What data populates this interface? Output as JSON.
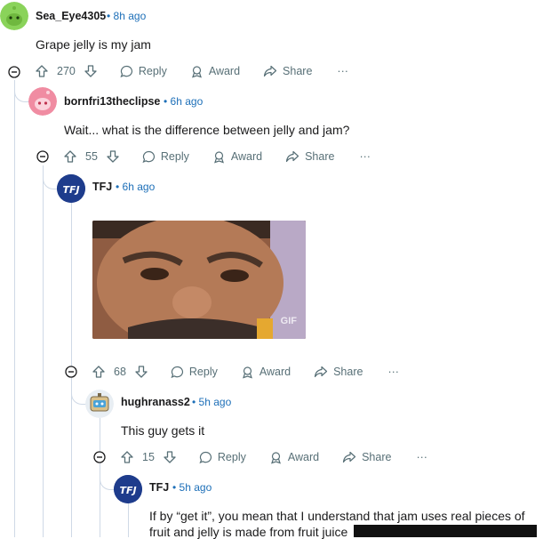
{
  "comments": [
    {
      "author": "Sea_Eye4305",
      "time": "8h ago",
      "text": "Grape jelly is my jam",
      "votes": "270",
      "avatar_color": "#8ad35a"
    },
    {
      "author": "bornfri13theclipse",
      "time": "6h ago",
      "text": "Wait... what is the difference between jelly and jam?",
      "votes": "55",
      "avatar_color": "#f08ca2"
    },
    {
      "author": "TFJ",
      "time": "6h ago",
      "text": "",
      "votes": "68",
      "avatar_color": "#1e3c8c",
      "avatar_text": "TFJ",
      "gif_label": "GIF"
    },
    {
      "author": "hughranass2",
      "time": "5h ago",
      "text": "This guy gets it",
      "votes": "15",
      "avatar_color": "#d9c08a"
    },
    {
      "author": "TFJ",
      "time": "5h ago",
      "text_line1": "If by “get it”, you mean that I understand that jam uses real pieces of",
      "text_line2": "fruit and jelly is made from fruit juice",
      "avatar_color": "#1e3c8c",
      "avatar_text": "TFJ"
    }
  ],
  "actions": {
    "reply": "Reply",
    "award": "Award",
    "share": "Share",
    "more": "···"
  },
  "separator": "•"
}
